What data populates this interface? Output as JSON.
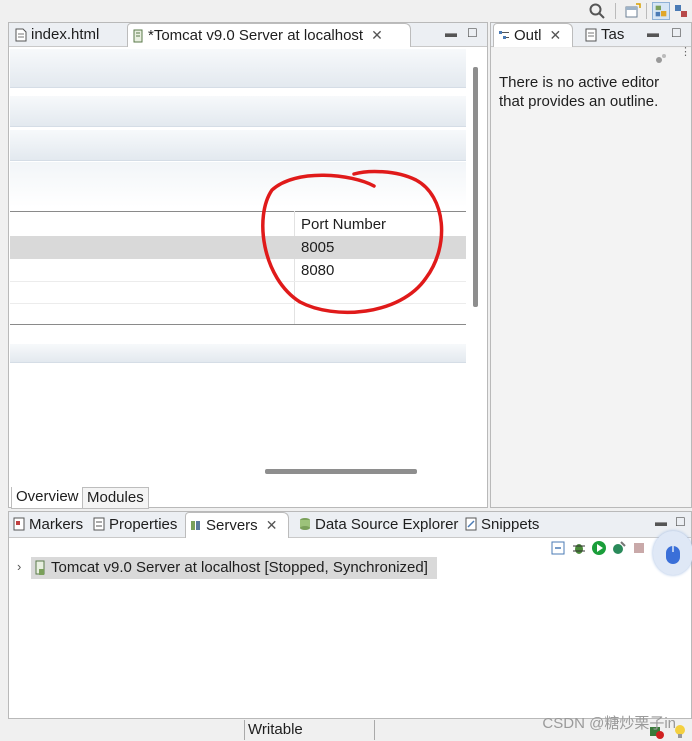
{
  "editor": {
    "tabs": [
      {
        "label": "index.html",
        "active": false
      },
      {
        "label": "*Tomcat v9.0 Server at localhost",
        "active": true
      }
    ],
    "ports": {
      "header": "Port Number",
      "rows": [
        "8005",
        "8080"
      ]
    },
    "bottom_tabs": [
      {
        "label": "Overview",
        "active": true
      },
      {
        "label": "Modules",
        "active": false
      }
    ]
  },
  "outline": {
    "tabs": [
      {
        "label": "Outl",
        "active": true
      },
      {
        "label": "Tas",
        "active": false
      }
    ],
    "message": "There is no active editor that provides an outline."
  },
  "servers_view": {
    "tabs": [
      {
        "label": "Markers",
        "active": false
      },
      {
        "label": "Properties",
        "active": false
      },
      {
        "label": "Servers",
        "active": true
      },
      {
        "label": "Data Source Explorer",
        "active": false
      },
      {
        "label": "Snippets",
        "active": false
      }
    ],
    "server": {
      "name": "Tomcat v9.0 Server at localhost",
      "state": "[Stopped, Synchronized]"
    }
  },
  "status": {
    "writable": "Writable"
  },
  "watermark": "CSDN @糖炒栗子in",
  "colors": {
    "annotation_red": "#e01a1a",
    "selection_gray": "#d9d9d9",
    "start_green": "#1a9e3a"
  }
}
